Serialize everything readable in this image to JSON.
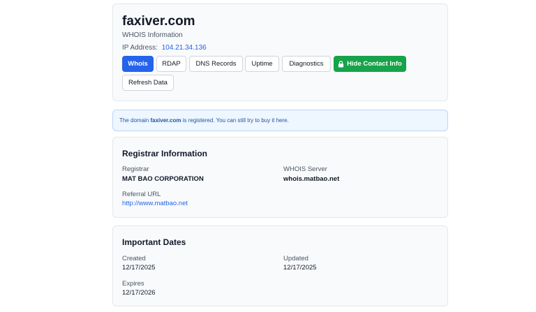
{
  "header": {
    "domain": "faxiver.com",
    "subtitle": "WHOIS Information",
    "ip_label": "IP Address:",
    "ip_value": "104.21.34.136"
  },
  "tabs": [
    {
      "label": "Whois",
      "active": true
    },
    {
      "label": "RDAP"
    },
    {
      "label": "DNS Records"
    },
    {
      "label": "Uptime"
    },
    {
      "label": "Diagnostics"
    }
  ],
  "buttons": {
    "hide_contact": "Hide Contact Info",
    "hide_contact_icon": "lock-icon",
    "refresh": "Refresh Data"
  },
  "alert": {
    "prefix": "The domain ",
    "domain": "faxiver.com",
    "suffix": " is registered. You can still try to buy it here."
  },
  "registrar": {
    "title": "Registrar Information",
    "registrar_label": "Registrar",
    "registrar_value": "MAT BAO CORPORATION",
    "whois_server_label": "WHOIS Server",
    "whois_server_value": "whois.matbao.net",
    "referral_label": "Referral URL",
    "referral_value": "http://www.matbao.net"
  },
  "dates": {
    "title": "Important Dates",
    "created_label": "Created",
    "created_value": "12/17/2025",
    "updated_label": "Updated",
    "updated_value": "12/17/2025",
    "expires_label": "Expires",
    "expires_value": "12/17/2026"
  },
  "colors": {
    "primary": "#2563eb",
    "success": "#16a34a",
    "card_bg": "#f8fafc",
    "alert_bg": "#eef6ff"
  }
}
